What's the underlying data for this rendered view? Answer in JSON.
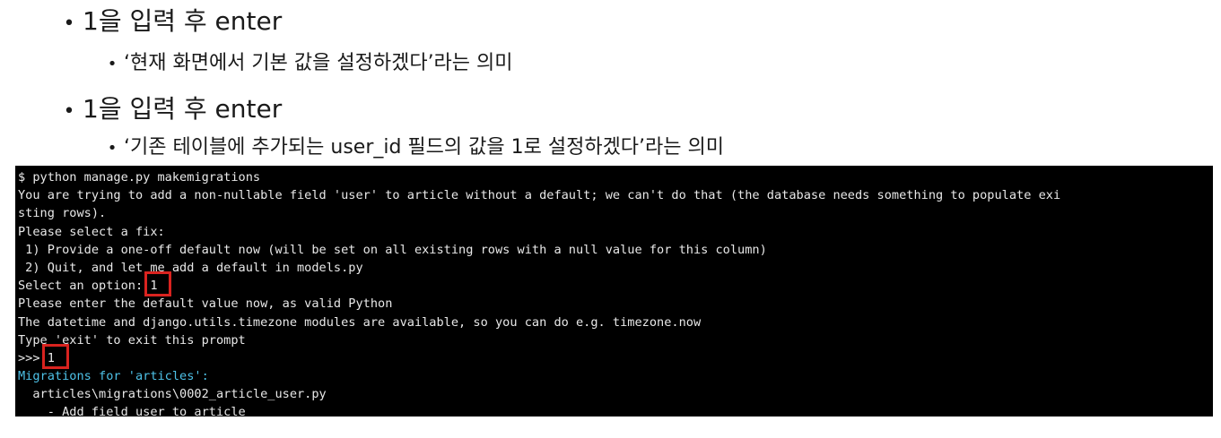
{
  "slide": {
    "bullets": [
      {
        "marker": "•",
        "text": "1을 입력 후 enter",
        "sub": {
          "marker": "•",
          "text": "‘현재 화면에서 기본 값을 설정하겠다’라는 의미"
        }
      },
      {
        "marker": "•",
        "text": "1을 입력 후 enter",
        "sub": {
          "marker": "•",
          "text": "‘기존 테이블에 추가되는 user_id 필드의 값을 1로 설정하겠다’라는 의미"
        }
      }
    ]
  },
  "terminal": {
    "lines": [
      "$ python manage.py makemigrations",
      "You are trying to add a non-nullable field 'user' to article without a default; we can't do that (the database needs something to populate exi",
      "sting rows).",
      "Please select a fix:",
      " 1) Provide a one-off default now (will be set on all existing rows with a null value for this column)",
      " 2) Quit, and let me add a default in models.py",
      "Select an option: ",
      "Please enter the default value now, as valid Python",
      "The datetime and django.utils.timezone modules are available, so you can do e.g. timezone.now",
      "Type 'exit' to exit this prompt",
      ">>> ",
      "Migrations for 'articles':",
      "  articles\\migrations\\0002_article_user.py",
      "    - Add field user to article"
    ],
    "input_option": "1",
    "input_default": "1",
    "colors": {
      "background": "#000000",
      "text": "#e8e8e8",
      "migrations_header": "#4ec2e8",
      "highlight_box": "#d9231f"
    }
  }
}
